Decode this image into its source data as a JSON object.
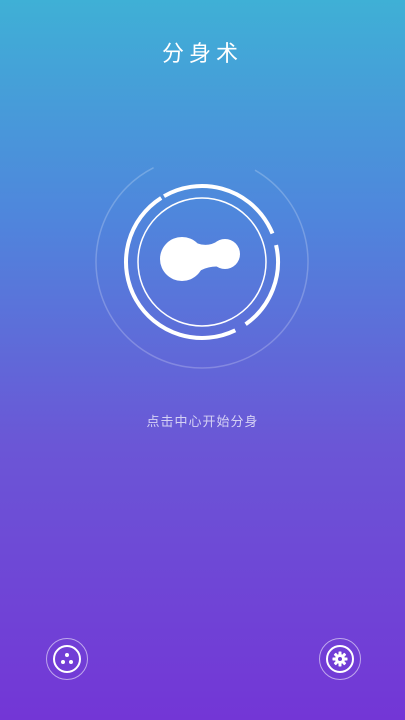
{
  "header": {
    "title": "分身术"
  },
  "main": {
    "hint": "点击中心开始分身",
    "center_icon": "clone-logo-icon"
  },
  "footer": {
    "left_icon": "apps-dots-icon",
    "right_icon": "gear-icon"
  },
  "colors": {
    "gradient_top": "#3fb0d6",
    "gradient_mid": "#5a73da",
    "gradient_bottom": "#7336d6",
    "foreground": "#ffffff"
  }
}
